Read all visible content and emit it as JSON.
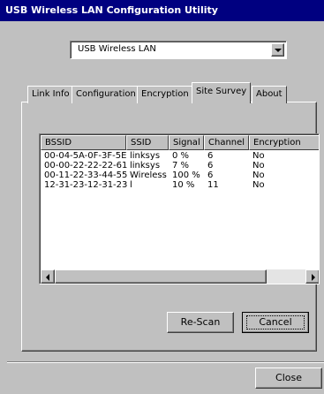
{
  "window": {
    "title": "USB Wireless LAN Configuration Utility"
  },
  "adapter": {
    "selected": "USB Wireless LAN"
  },
  "tabs": [
    {
      "label": "Link Info"
    },
    {
      "label": "Configuration"
    },
    {
      "label": "Encryption"
    },
    {
      "label": "Site Survey",
      "active": true
    },
    {
      "label": "About"
    }
  ],
  "site_survey": {
    "columns": [
      "BSSID",
      "SSID",
      "Signal",
      "Channel",
      "Encryption"
    ],
    "rows": [
      [
        "00-04-5A-0F-3F-5E",
        "linksys",
        "0 %",
        "6",
        "No"
      ],
      [
        "00-00-22-22-22-61",
        "linksys",
        "7 %",
        "6",
        "No"
      ],
      [
        "00-11-22-33-44-55",
        "Wireless",
        "100 %",
        "6",
        "No"
      ],
      [
        "12-31-23-12-31-23",
        "l",
        "10 %",
        "11",
        "No"
      ]
    ],
    "rescan_label": "Re-Scan",
    "cancel_label": "Cancel"
  },
  "footer": {
    "close_label": "Close"
  }
}
